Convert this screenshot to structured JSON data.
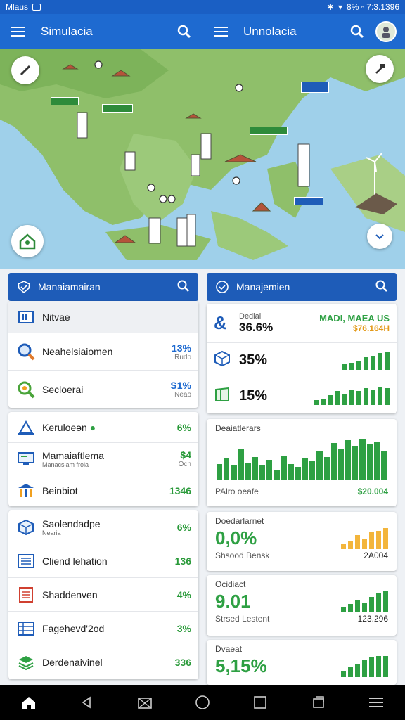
{
  "status_bar": {
    "left_text": "Mlaus",
    "right_text": "8% ▫ 7:3.1396"
  },
  "app_bar": {
    "left_title": "Simulacia",
    "right_title": "Unnolacia"
  },
  "map": {
    "labels": [
      {
        "text": "",
        "color": "#2e8b3a"
      },
      {
        "text": "",
        "color": "#2e8b3a"
      },
      {
        "text": "",
        "color": "#2e8b3a"
      },
      {
        "text": "",
        "color": "#1e5cb8"
      },
      {
        "text": "",
        "color": "#1e5cb8"
      }
    ]
  },
  "left_panel": {
    "title": "Manaiamairan",
    "group1": [
      {
        "label": "Nitvae",
        "icon": "list-icon",
        "value": "",
        "sub": ""
      },
      {
        "label": "Neahelsiaiomen",
        "icon": "magnifier-icon",
        "value": "13%",
        "sub": "Rudo"
      },
      {
        "label": "Secloerai",
        "icon": "search-circle-icon",
        "value": "S1%",
        "sub": "Neao"
      }
    ],
    "group2": [
      {
        "label": "Keruloeən",
        "icon": "triangle-ruler-icon",
        "value": "6%",
        "sub": "",
        "sublabel": ""
      },
      {
        "label": "Mamaiaftlema",
        "icon": "monitor-icon",
        "value": "$4",
        "sub": "Ocn",
        "sublabel": "Manacsiam frola"
      },
      {
        "label": "Beinbiot",
        "icon": "building-icon",
        "value": "1346",
        "sub": "",
        "sublabel": ""
      }
    ],
    "group3": [
      {
        "label": "Saolendadpe",
        "sublabel": "Nearia",
        "icon": "cube-icon",
        "value": "6%"
      },
      {
        "label": "Cliend lehation",
        "sublabel": "",
        "icon": "server-icon",
        "value": "136"
      },
      {
        "label": "Shaddenven",
        "sublabel": "",
        "icon": "document-icon",
        "value": "4%"
      },
      {
        "label": "Fagehevd'2od",
        "sublabel": "",
        "icon": "table-icon",
        "value": "3%"
      },
      {
        "label": "Derdenaivinel",
        "sublabel": "",
        "icon": "stack-icon",
        "value": "336"
      }
    ]
  },
  "right_panel": {
    "title": "Manajemien",
    "metrics": [
      {
        "label": "Dedial",
        "value": "36.6%",
        "icon": "ampersand-icon",
        "tag": "MADI, MAEA US",
        "tag2": "$76.164H"
      },
      {
        "label": "",
        "value": "35%",
        "icon": "hexagon-icon",
        "tag": "",
        "tag2": ""
      },
      {
        "label": "",
        "value": "15%",
        "icon": "box-icon",
        "tag": "",
        "tag2": ""
      }
    ],
    "chart_card": {
      "title": "Deaiatlerars",
      "footer_left": "PAlro oeafe",
      "footer_right": "$20.004"
    },
    "card_a": {
      "title": "Doedarlarnet",
      "value": "0,0%",
      "footer_left": "Shsood Bensk",
      "footer_right": "2A004"
    },
    "card_b": {
      "title": "Ocidiact",
      "value": "9.01",
      "footer_left": "Strsed Lestent",
      "footer_right": "123.296"
    },
    "card_c": {
      "title": "Dvaeat",
      "value": "5,15%"
    }
  },
  "colors": {
    "primary": "#1e6ad0",
    "header": "#1e5cb8",
    "green": "#2ea043",
    "amber": "#f3b53b"
  }
}
